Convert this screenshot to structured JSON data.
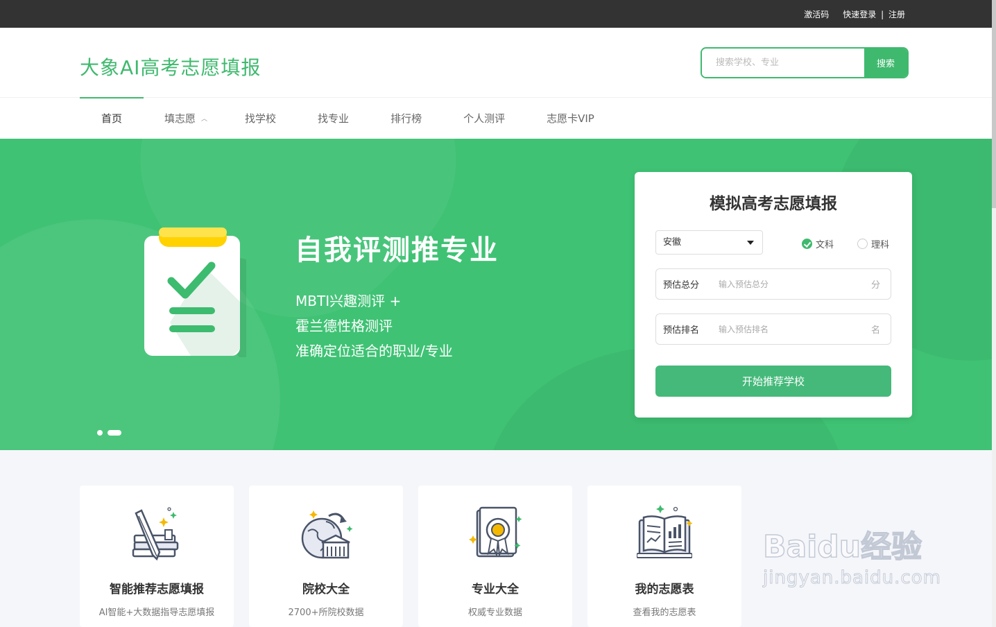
{
  "topbar": {
    "activation": "激活码",
    "login": "快速登录",
    "separator": "|",
    "register": "注册"
  },
  "header": {
    "logo": "大象AI高考志愿填报",
    "search_placeholder": "搜索学校、专业",
    "search_button": "搜索"
  },
  "nav": [
    {
      "label": "首页"
    },
    {
      "label": "填志愿"
    },
    {
      "label": "找学校"
    },
    {
      "label": "找专业"
    },
    {
      "label": "排行榜"
    },
    {
      "label": "个人测评"
    },
    {
      "label": "志愿卡VIP"
    }
  ],
  "banner": {
    "title": "自我评测推专业",
    "lines": [
      "MBTI兴趣测评 +",
      "霍兰德性格测评",
      "准确定位适合的职业/专业"
    ],
    "carousel_active": 2,
    "carousel_count": 2
  },
  "form": {
    "title": "模拟高考志愿填报",
    "province": "安徽",
    "subject_options": [
      "文科",
      "理科"
    ],
    "selected_subject": "文科",
    "score_label": "预估总分",
    "score_placeholder": "输入预估总分",
    "score_unit": "分",
    "rank_label": "预估排名",
    "rank_placeholder": "输入预估排名",
    "rank_unit": "名",
    "submit": "开始推荐学校"
  },
  "features": [
    {
      "title": "智能推荐志愿填报",
      "subtitle": "AI智能+大数据指导志愿填报",
      "icon": "pencil-books-icon"
    },
    {
      "title": "院校大全",
      "subtitle": "2700+所院校数据",
      "icon": "globe-school-icon"
    },
    {
      "title": "专业大全",
      "subtitle": "权威专业数据",
      "icon": "certificate-award-icon"
    },
    {
      "title": "我的志愿表",
      "subtitle": "查看我的志愿表",
      "icon": "open-book-chart-icon"
    }
  ],
  "watermark": {
    "brand": "Baidu经验",
    "url": "jingyan.baidu.com"
  },
  "colors": {
    "brand": "#3fb96e",
    "banner": "#3fc274",
    "topbar": "#333333"
  }
}
